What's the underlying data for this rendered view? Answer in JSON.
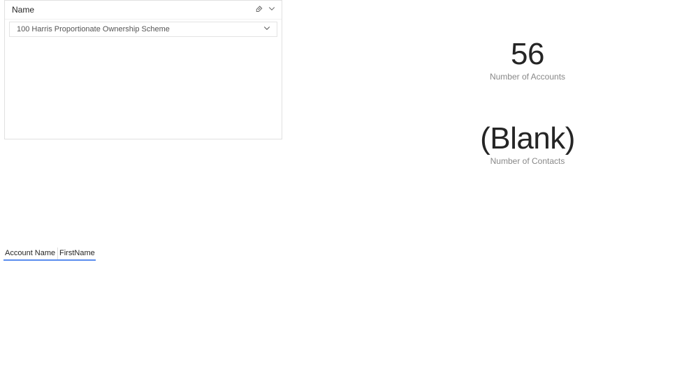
{
  "slicer": {
    "title": "Name",
    "selected_value": "100 Harris Proportionate Ownership Scheme"
  },
  "kpi": {
    "accounts": {
      "value": "56",
      "label": "Number of Accounts"
    },
    "contacts": {
      "value": "(Blank)",
      "label": "Number of Contacts"
    }
  },
  "table": {
    "columns": [
      "Account Name",
      "FirstName"
    ]
  }
}
